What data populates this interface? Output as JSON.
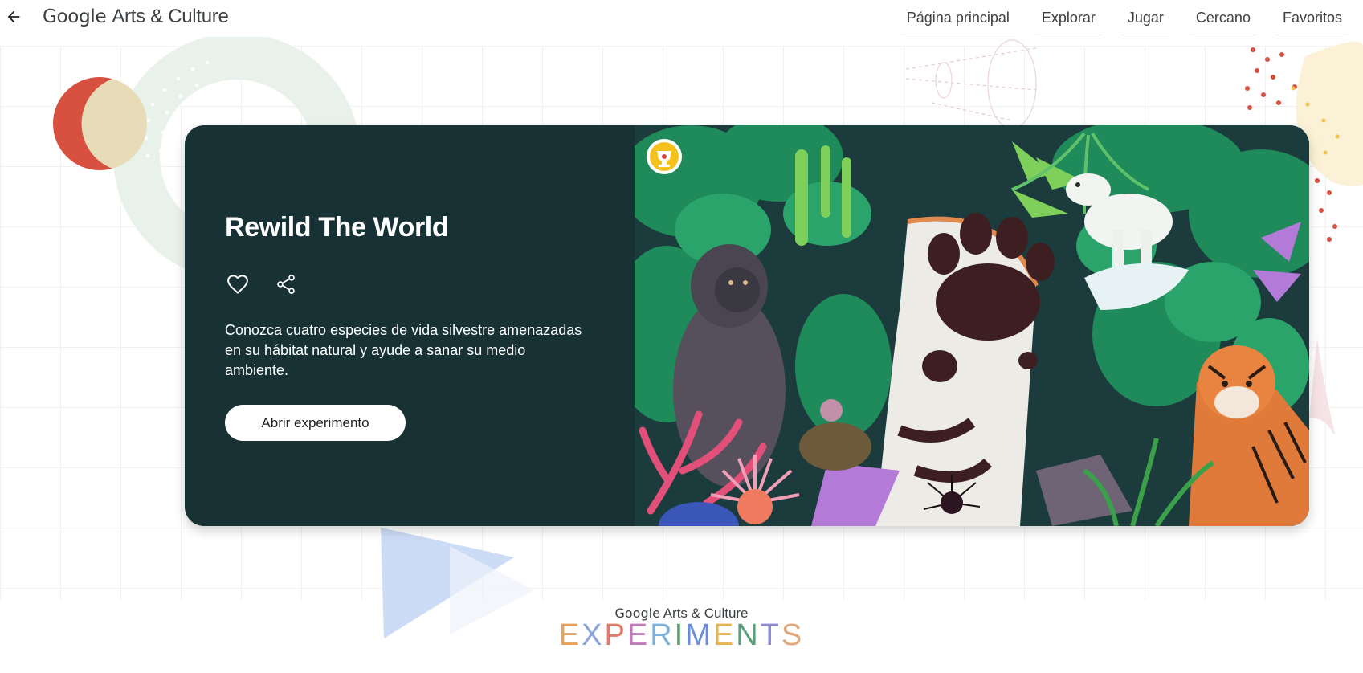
{
  "header": {
    "back_icon": "arrow-left-icon",
    "logo_google": "Google",
    "logo_rest": "Arts & Culture",
    "nav": [
      {
        "label": "Página principal"
      },
      {
        "label": "Explorar"
      },
      {
        "label": "Jugar"
      },
      {
        "label": "Cercano"
      },
      {
        "label": "Favoritos"
      }
    ]
  },
  "card": {
    "title": "Rewild The World",
    "favorite_icon": "heart-outline-icon",
    "share_icon": "share-icon",
    "description": "Conozca cuatro especies de vida silvestre amenazadas en su hábitat natural y ayude a sanar su medio ambiente.",
    "cta_label": "Abrir experimento",
    "badge_icon": "trophy-icon",
    "background_color": "#173135"
  },
  "footer": {
    "brand_google": "Google",
    "brand_rest": "Arts & Culture",
    "experiments_letters": [
      "E",
      "X",
      "P",
      "E",
      "R",
      "I",
      "M",
      "E",
      "N",
      "T",
      "S"
    ],
    "experiments_colors": [
      "#e8a25c",
      "#8aa5d9",
      "#e07a6a",
      "#c07ab8",
      "#7fb1d9",
      "#5aa06a",
      "#6c8ed6",
      "#e5b352",
      "#5aa07a",
      "#8d8ad0",
      "#e0a87a"
    ]
  }
}
